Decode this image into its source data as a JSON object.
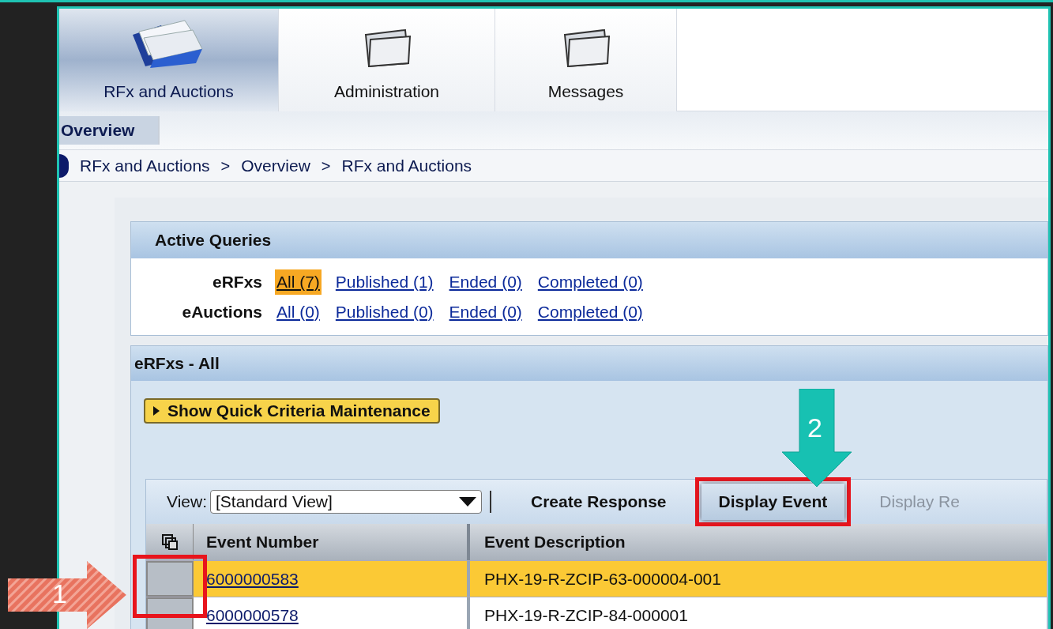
{
  "tabs": [
    {
      "label": "RFx and Auctions",
      "selected": true,
      "kind": "papers"
    },
    {
      "label": "Administration",
      "selected": false,
      "kind": "folder"
    },
    {
      "label": "Messages",
      "selected": false,
      "kind": "folder"
    }
  ],
  "sub_tabs": [
    {
      "label": "Overview",
      "selected": true
    }
  ],
  "breadcrumb": [
    "RFx and Auctions",
    "Overview",
    "RFx and Auctions"
  ],
  "breadcrumb_separator": ">",
  "active_queries": {
    "title": "Active Queries",
    "groups": [
      {
        "label": "eRFxs",
        "links": [
          {
            "label": "All (7)",
            "selected": true
          },
          {
            "label": "Published (1)",
            "selected": false
          },
          {
            "label": "Ended (0)",
            "selected": false
          },
          {
            "label": "Completed (0)",
            "selected": false
          }
        ]
      },
      {
        "label": "eAuctions",
        "links": [
          {
            "label": "All (0)",
            "selected": false
          },
          {
            "label": "Published (0)",
            "selected": false
          },
          {
            "label": "Ended (0)",
            "selected": false
          },
          {
            "label": "Completed (0)",
            "selected": false
          }
        ]
      }
    ]
  },
  "list": {
    "title": "eRFxs - All",
    "criteria_button": "Show Quick Criteria Maintenance",
    "view_label": "View:",
    "view_value": "[Standard View]",
    "actions": [
      {
        "label": "Create Response",
        "disabled": false,
        "highlighted": false
      },
      {
        "label": "Display Event",
        "disabled": false,
        "highlighted": true
      },
      {
        "label": "Display Re",
        "disabled": true,
        "highlighted": false
      }
    ],
    "columns": [
      "Event Number",
      "Event Description"
    ],
    "rows": [
      {
        "number": "6000000583",
        "description": "PHX-19-R-ZCIP-63-000004-001",
        "selected": true
      },
      {
        "number": "6000000578",
        "description": "PHX-19-R-ZCIP-84-000001",
        "selected": false
      }
    ]
  },
  "annotations": [
    {
      "label": "1",
      "kind": "stripe"
    },
    {
      "label": "2",
      "kind": "teal"
    }
  ]
}
